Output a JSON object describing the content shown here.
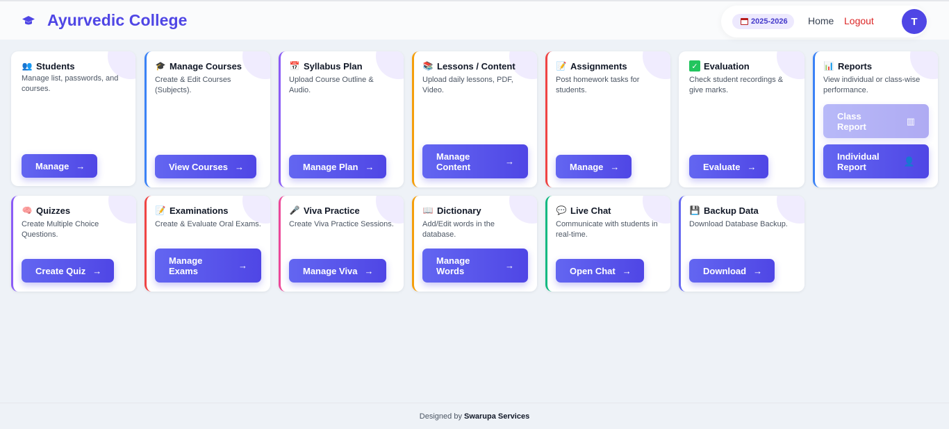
{
  "header": {
    "title": "Ayurvedic College",
    "year": "2025-2026",
    "nav_home": "Home",
    "nav_logout": "Logout",
    "avatar_initial": "T"
  },
  "cards": [
    {
      "title": "Students",
      "icon": "people-icon",
      "desc": "Manage list, passwords, and courses.",
      "button": "Manage"
    },
    {
      "title": "Manage Courses",
      "icon": "graduation-cap-icon",
      "desc": "Create & Edit Courses (Subjects).",
      "button": "View Courses"
    },
    {
      "title": "Syllabus Plan",
      "icon": "calendar-icon",
      "desc": "Upload Course Outline & Audio.",
      "button": "Manage Plan"
    },
    {
      "title": "Lessons / Content",
      "icon": "books-icon",
      "desc": "Upload daily lessons, PDF, Video.",
      "button": "Manage Content"
    },
    {
      "title": "Assignments",
      "icon": "memo-icon",
      "desc": "Post homework tasks for students.",
      "button": "Manage"
    },
    {
      "title": "Evaluation",
      "icon": "checkmark-icon",
      "desc": "Check student recordings & give marks.",
      "button": "Evaluate"
    },
    {
      "title": "Reports",
      "icon": "bar-chart-icon",
      "desc": "View individual or class-wise performance.",
      "button": "Class Report",
      "button2": "Individual Report"
    },
    {
      "title": "Quizzes",
      "icon": "brain-icon",
      "desc": "Create Multiple Choice Questions.",
      "button": "Create Quiz"
    },
    {
      "title": "Examinations",
      "icon": "memo-icon",
      "desc": "Create & Evaluate Oral Exams.",
      "button": "Manage Exams"
    },
    {
      "title": "Viva Practice",
      "icon": "microphone-icon",
      "desc": "Create Viva Practice Sessions.",
      "button": "Manage Viva"
    },
    {
      "title": "Dictionary",
      "icon": "book-icon",
      "desc": "Add/Edit words in the database.",
      "button": "Manage Words"
    },
    {
      "title": "Live Chat",
      "icon": "chat-icon",
      "desc": "Communicate with students in real-time.",
      "button": "Open Chat"
    },
    {
      "title": "Backup Data",
      "icon": "floppy-disk-icon",
      "desc": "Download Database Backup.",
      "button": "Download"
    }
  ],
  "colors": {
    "accent": "#4f46e5",
    "border_blue": "#3b82f6",
    "border_purple": "#8b5cf6",
    "border_amber": "#f59e0b",
    "border_red": "#ef4444",
    "border_pink": "#ec4899",
    "border_green": "#10b981",
    "border_indigo": "#6366f1"
  },
  "footer": {
    "prefix": "Designed by",
    "company": "Swarupa Services"
  }
}
